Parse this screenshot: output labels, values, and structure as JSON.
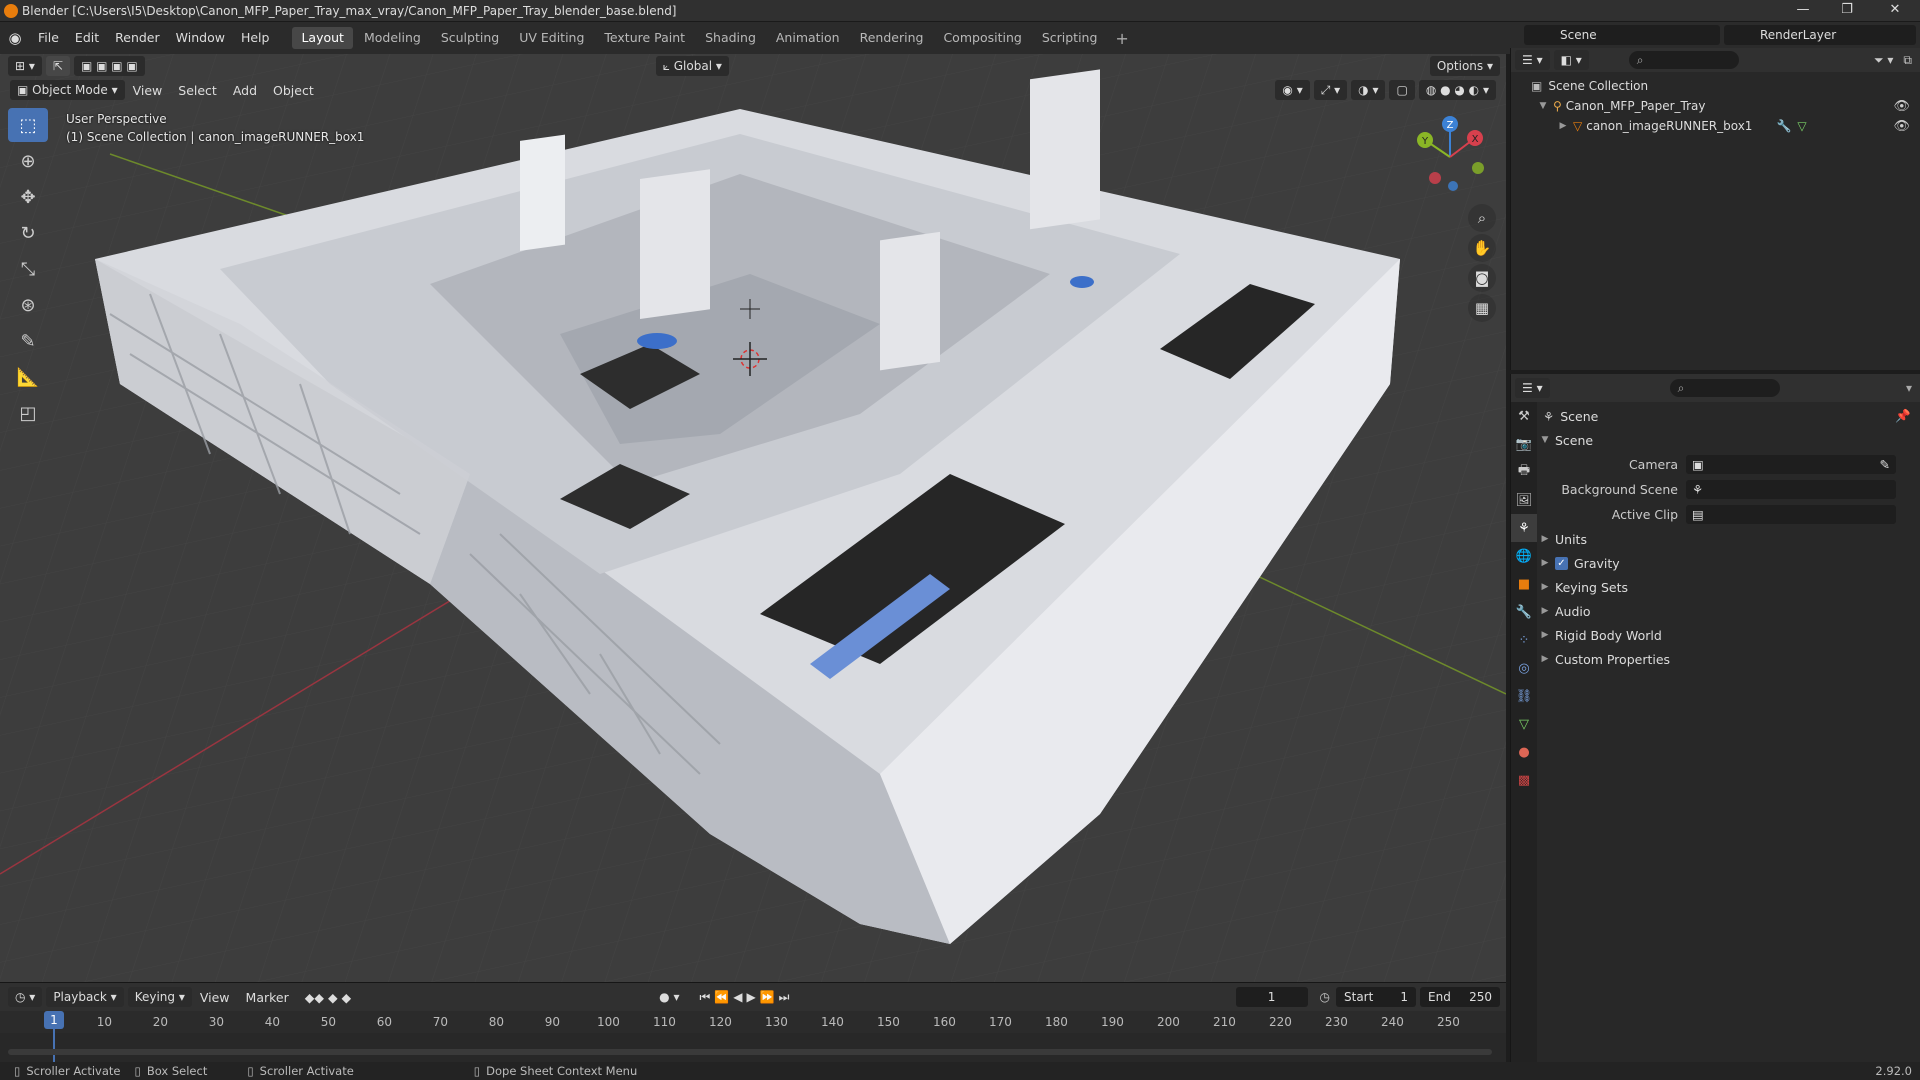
{
  "window": {
    "title": "Blender [C:\\Users\\I5\\Desktop\\Canon_MFP_Paper_Tray_max_vray/Canon_MFP_Paper_Tray_blender_base.blend]",
    "min": "—",
    "max": "❐",
    "close": "✕"
  },
  "menu": {
    "items": [
      "File",
      "Edit",
      "Render",
      "Window",
      "Help"
    ],
    "workspaces": [
      "Layout",
      "Modeling",
      "Sculpting",
      "UV Editing",
      "Texture Paint",
      "Shading",
      "Animation",
      "Rendering",
      "Compositing",
      "Scripting"
    ],
    "active_workspace": "Layout",
    "add": "+"
  },
  "scene_selector": "Scene",
  "layer_selector": "RenderLayer",
  "viewport": {
    "mode": "Object Mode",
    "menus": [
      "View",
      "Select",
      "Add",
      "Object"
    ],
    "orientation": "Global",
    "options": "Options",
    "info_line1": "User Perspective",
    "info_line2": "(1) Scene Collection | canon_imageRUNNER_box1",
    "gizmo": {
      "x": "X",
      "y": "Y",
      "z": "Z"
    }
  },
  "outliner": {
    "root": "Scene Collection",
    "collection": "Canon_MFP_Paper_Tray",
    "object": "canon_imageRUNNER_box1"
  },
  "properties": {
    "header_title": "Scene",
    "panel_title": "Scene",
    "fields": [
      {
        "label": "Camera",
        "value": ""
      },
      {
        "label": "Background Scene",
        "value": ""
      },
      {
        "label": "Active Clip",
        "value": ""
      }
    ],
    "sections": [
      "Units",
      "Gravity",
      "Keying Sets",
      "Audio",
      "Rigid Body World",
      "Custom Properties"
    ],
    "gravity_checked": true
  },
  "timeline": {
    "menus": [
      "Playback",
      "Keying",
      "View",
      "Marker"
    ],
    "current_frame": "1",
    "start_label": "Start",
    "start": "1",
    "end_label": "End",
    "end": "250",
    "ruler": [
      "1",
      "10",
      "20",
      "30",
      "40",
      "50",
      "60",
      "70",
      "80",
      "90",
      "100",
      "110",
      "120",
      "130",
      "140",
      "150",
      "160",
      "170",
      "180",
      "190",
      "200",
      "210",
      "220",
      "230",
      "240",
      "250"
    ]
  },
  "statusbar": {
    "items": [
      "Scroller Activate",
      "Box Select",
      "Scroller Activate",
      "Dope Sheet Context Menu"
    ],
    "version": "2.92.0"
  },
  "colors": {
    "accent": "#4772b3",
    "x_axis": "#d7404d",
    "y_axis": "#8ab626",
    "z_axis": "#3c82d6",
    "orange": "#e87d0d"
  }
}
